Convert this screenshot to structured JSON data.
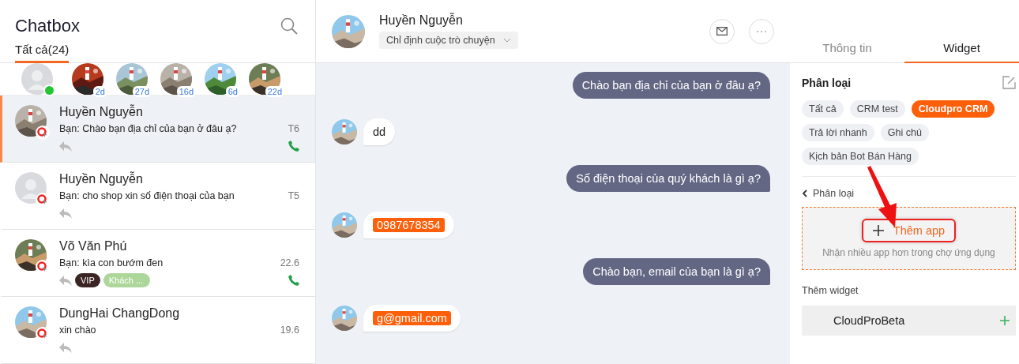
{
  "sidebar": {
    "title": "Chatbox",
    "tabs": [
      {
        "label": "Tất cả(24)",
        "selected": true
      }
    ],
    "recent": [
      {
        "kind": "default",
        "online": true
      },
      {
        "badge": "2d",
        "online": false
      },
      {
        "badge": "27d",
        "online": false
      },
      {
        "badge": "16d",
        "online": false
      },
      {
        "badge": "6d",
        "online": false
      },
      {
        "badge": "22d",
        "online": false
      }
    ],
    "conversations": [
      {
        "name": "Huyền Nguyễn",
        "preview": "Bạn: Chào bạn địa chỉ của bạn ở đâu ạ?",
        "time": "T6",
        "call": true,
        "selected": true
      },
      {
        "name": "Huyền Nguyễn",
        "preview": "Bạn: cho shop xin số điện thoại của bạn",
        "time": "T5",
        "kind": "default",
        "call": false,
        "selected": false
      },
      {
        "name": "Võ Văn Phú",
        "preview": "Bạn: kìa con bướm đen",
        "time": "22.6",
        "call": true,
        "selected": false,
        "tags": [
          {
            "label": "VIP",
            "color": "#3b2424"
          },
          {
            "label": "Khách ...",
            "color": "#add79a"
          }
        ]
      },
      {
        "name": "DungHai ChangDong",
        "preview": "xin chào",
        "time": "19.6",
        "call": false,
        "selected": false
      }
    ]
  },
  "chat": {
    "contact": "Huyền Nguyễn",
    "assign": "Chỉ định cuộc trò chuyện",
    "messages": [
      {
        "kind": "sent",
        "text": "Chào bạn địa chỉ của bạn ở đâu ạ?"
      },
      {
        "kind": "received",
        "text": "dd"
      },
      {
        "kind": "sent",
        "text": "Số điện thoại của quý khách là gì ạ?"
      },
      {
        "kind": "detected",
        "text": "0987678354"
      },
      {
        "kind": "sent",
        "text": "Chào bạn, email của bạn là gì ạ?"
      },
      {
        "kind": "detected",
        "text": "g@gmail.com"
      }
    ]
  },
  "panel": {
    "tabs": [
      {
        "label": "Thông tin",
        "selected": false
      },
      {
        "label": "Widget",
        "selected": true
      }
    ],
    "section": "Phân loại",
    "filters": [
      {
        "label": "Tất cả",
        "selected": false
      },
      {
        "label": "CRM test",
        "selected": false
      },
      {
        "label": "Cloudpro CRM",
        "selected": true
      },
      {
        "label": "Trả lời nhanh",
        "selected": false
      },
      {
        "label": "Ghi chú",
        "selected": false
      },
      {
        "label": "Kịch bản Bot Bán Hàng",
        "selected": false
      }
    ],
    "back": "Phân loại",
    "add_app": {
      "label": "Thêm app",
      "hint": "Nhận nhiều app hơn trong chợ ứng dụng"
    },
    "add_widget_title": "Thêm widget",
    "widgets": [
      {
        "name": "CloudProBeta"
      }
    ]
  }
}
